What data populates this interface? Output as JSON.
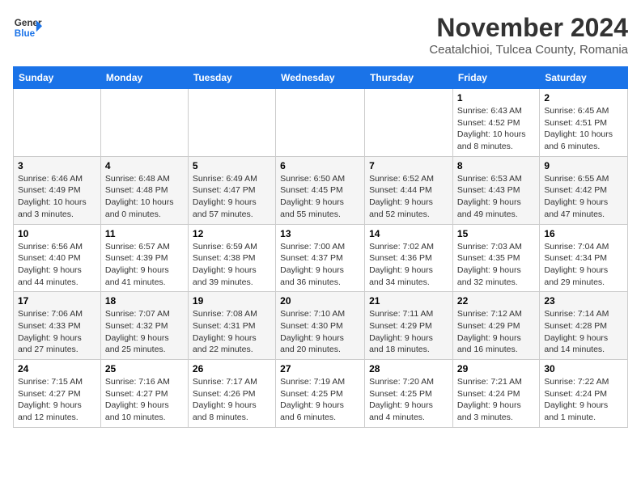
{
  "logo": {
    "line1": "General",
    "line2": "Blue"
  },
  "header": {
    "month": "November 2024",
    "location": "Ceatalchioi, Tulcea County, Romania"
  },
  "weekdays": [
    "Sunday",
    "Monday",
    "Tuesday",
    "Wednesday",
    "Thursday",
    "Friday",
    "Saturday"
  ],
  "weeks": [
    [
      {
        "day": "",
        "info": ""
      },
      {
        "day": "",
        "info": ""
      },
      {
        "day": "",
        "info": ""
      },
      {
        "day": "",
        "info": ""
      },
      {
        "day": "",
        "info": ""
      },
      {
        "day": "1",
        "info": "Sunrise: 6:43 AM\nSunset: 4:52 PM\nDaylight: 10 hours and 8 minutes."
      },
      {
        "day": "2",
        "info": "Sunrise: 6:45 AM\nSunset: 4:51 PM\nDaylight: 10 hours and 6 minutes."
      }
    ],
    [
      {
        "day": "3",
        "info": "Sunrise: 6:46 AM\nSunset: 4:49 PM\nDaylight: 10 hours and 3 minutes."
      },
      {
        "day": "4",
        "info": "Sunrise: 6:48 AM\nSunset: 4:48 PM\nDaylight: 10 hours and 0 minutes."
      },
      {
        "day": "5",
        "info": "Sunrise: 6:49 AM\nSunset: 4:47 PM\nDaylight: 9 hours and 57 minutes."
      },
      {
        "day": "6",
        "info": "Sunrise: 6:50 AM\nSunset: 4:45 PM\nDaylight: 9 hours and 55 minutes."
      },
      {
        "day": "7",
        "info": "Sunrise: 6:52 AM\nSunset: 4:44 PM\nDaylight: 9 hours and 52 minutes."
      },
      {
        "day": "8",
        "info": "Sunrise: 6:53 AM\nSunset: 4:43 PM\nDaylight: 9 hours and 49 minutes."
      },
      {
        "day": "9",
        "info": "Sunrise: 6:55 AM\nSunset: 4:42 PM\nDaylight: 9 hours and 47 minutes."
      }
    ],
    [
      {
        "day": "10",
        "info": "Sunrise: 6:56 AM\nSunset: 4:40 PM\nDaylight: 9 hours and 44 minutes."
      },
      {
        "day": "11",
        "info": "Sunrise: 6:57 AM\nSunset: 4:39 PM\nDaylight: 9 hours and 41 minutes."
      },
      {
        "day": "12",
        "info": "Sunrise: 6:59 AM\nSunset: 4:38 PM\nDaylight: 9 hours and 39 minutes."
      },
      {
        "day": "13",
        "info": "Sunrise: 7:00 AM\nSunset: 4:37 PM\nDaylight: 9 hours and 36 minutes."
      },
      {
        "day": "14",
        "info": "Sunrise: 7:02 AM\nSunset: 4:36 PM\nDaylight: 9 hours and 34 minutes."
      },
      {
        "day": "15",
        "info": "Sunrise: 7:03 AM\nSunset: 4:35 PM\nDaylight: 9 hours and 32 minutes."
      },
      {
        "day": "16",
        "info": "Sunrise: 7:04 AM\nSunset: 4:34 PM\nDaylight: 9 hours and 29 minutes."
      }
    ],
    [
      {
        "day": "17",
        "info": "Sunrise: 7:06 AM\nSunset: 4:33 PM\nDaylight: 9 hours and 27 minutes."
      },
      {
        "day": "18",
        "info": "Sunrise: 7:07 AM\nSunset: 4:32 PM\nDaylight: 9 hours and 25 minutes."
      },
      {
        "day": "19",
        "info": "Sunrise: 7:08 AM\nSunset: 4:31 PM\nDaylight: 9 hours and 22 minutes."
      },
      {
        "day": "20",
        "info": "Sunrise: 7:10 AM\nSunset: 4:30 PM\nDaylight: 9 hours and 20 minutes."
      },
      {
        "day": "21",
        "info": "Sunrise: 7:11 AM\nSunset: 4:29 PM\nDaylight: 9 hours and 18 minutes."
      },
      {
        "day": "22",
        "info": "Sunrise: 7:12 AM\nSunset: 4:29 PM\nDaylight: 9 hours and 16 minutes."
      },
      {
        "day": "23",
        "info": "Sunrise: 7:14 AM\nSunset: 4:28 PM\nDaylight: 9 hours and 14 minutes."
      }
    ],
    [
      {
        "day": "24",
        "info": "Sunrise: 7:15 AM\nSunset: 4:27 PM\nDaylight: 9 hours and 12 minutes."
      },
      {
        "day": "25",
        "info": "Sunrise: 7:16 AM\nSunset: 4:27 PM\nDaylight: 9 hours and 10 minutes."
      },
      {
        "day": "26",
        "info": "Sunrise: 7:17 AM\nSunset: 4:26 PM\nDaylight: 9 hours and 8 minutes."
      },
      {
        "day": "27",
        "info": "Sunrise: 7:19 AM\nSunset: 4:25 PM\nDaylight: 9 hours and 6 minutes."
      },
      {
        "day": "28",
        "info": "Sunrise: 7:20 AM\nSunset: 4:25 PM\nDaylight: 9 hours and 4 minutes."
      },
      {
        "day": "29",
        "info": "Sunrise: 7:21 AM\nSunset: 4:24 PM\nDaylight: 9 hours and 3 minutes."
      },
      {
        "day": "30",
        "info": "Sunrise: 7:22 AM\nSunset: 4:24 PM\nDaylight: 9 hours and 1 minute."
      }
    ]
  ]
}
